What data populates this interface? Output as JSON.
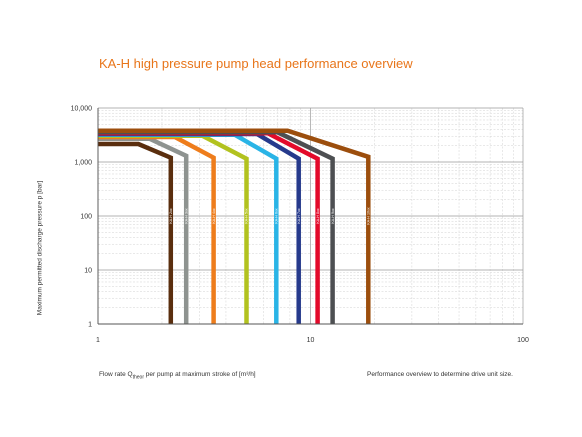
{
  "title": "KA-H high pressure pump head performance overview",
  "ylabel": "Maximum permitted discharge pressure p [bar]",
  "xlabel_prefix": "Flow rate Q",
  "xlabel_sub": "theor",
  "xlabel_suffix": " per pump at maximum stroke of [m³/h]",
  "note": "Performance overview to determine drive unit size.",
  "chart_data": {
    "type": "line",
    "x_scale": "log",
    "y_scale": "log",
    "xlim": [
      1,
      100
    ],
    "ylim": [
      1,
      10000
    ],
    "x_ticks": [
      1,
      10,
      100
    ],
    "x_tick_labels": [
      "1",
      "10",
      "100"
    ],
    "y_ticks": [
      1,
      10,
      100,
      1000,
      10000
    ],
    "y_tick_labels": [
      "1",
      "10",
      "100",
      "1,000",
      "10,000"
    ],
    "grid": true,
    "legend": "none",
    "series": [
      {
        "label": "KA-H 2xx",
        "color": "#5a2e0e",
        "points": [
          [
            1,
            2150
          ],
          [
            1.55,
            2150
          ],
          [
            2.2,
            1200
          ],
          [
            2.2,
            1
          ]
        ]
      },
      {
        "label": "KA-H 3xx",
        "color": "#8e9390",
        "points": [
          [
            1,
            2700
          ],
          [
            1.75,
            2700
          ],
          [
            2.6,
            1300
          ],
          [
            2.6,
            1
          ]
        ]
      },
      {
        "label": "KA-H 4xx",
        "color": "#ee7d1c",
        "points": [
          [
            1,
            2900
          ],
          [
            2.3,
            2900
          ],
          [
            3.5,
            1200
          ],
          [
            3.5,
            1
          ]
        ]
      },
      {
        "label": "KA-H 5xx",
        "color": "#b2c21f",
        "points": [
          [
            1,
            3050
          ],
          [
            3.1,
            3050
          ],
          [
            5.0,
            1150
          ],
          [
            5.0,
            1
          ]
        ]
      },
      {
        "label": "KA-H 6xx",
        "color": "#2ab4e6",
        "points": [
          [
            1,
            3200
          ],
          [
            4.4,
            3200
          ],
          [
            6.9,
            1150
          ],
          [
            6.9,
            1
          ]
        ]
      },
      {
        "label": "KA-H 7xx",
        "color": "#263a8c",
        "points": [
          [
            1,
            3300
          ],
          [
            5.6,
            3300
          ],
          [
            8.8,
            1150
          ],
          [
            8.8,
            1
          ]
        ]
      },
      {
        "label": "KA-H 8xx",
        "color": "#e30a2a",
        "points": [
          [
            1,
            3400
          ],
          [
            6.3,
            3400
          ],
          [
            10.8,
            1150
          ],
          [
            10.8,
            1
          ]
        ]
      },
      {
        "label": "KA-H 9xx",
        "color": "#4d4f52",
        "points": [
          [
            1,
            3550
          ],
          [
            7.0,
            3550
          ],
          [
            12.7,
            1150
          ],
          [
            12.7,
            1
          ]
        ]
      },
      {
        "label": "KA-H 10xx",
        "color": "#9c4e0d",
        "points": [
          [
            1,
            3800
          ],
          [
            7.8,
            3800
          ],
          [
            18.7,
            1250
          ],
          [
            18.7,
            1
          ]
        ]
      }
    ]
  }
}
